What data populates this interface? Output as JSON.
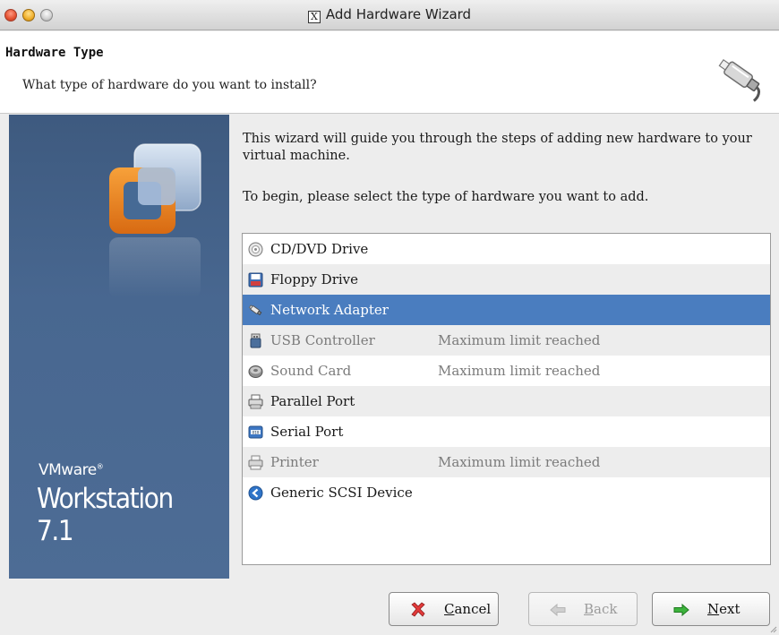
{
  "window": {
    "title": "Add Hardware Wizard"
  },
  "header": {
    "title": "Hardware Type",
    "subtitle": "What type of hardware do you want to install?"
  },
  "banner": {
    "brand_line1": "VMware",
    "brand_mark": "®",
    "brand_line2": "Workstation 7.1"
  },
  "intro": {
    "line1": "This wizard will guide you through the steps of adding new hardware to your virtual machine.",
    "line2": "To begin, please select the type of hardware you want to add."
  },
  "hardware_list": {
    "items": [
      {
        "label": "CD/DVD Drive",
        "note": "",
        "icon": "cd-icon",
        "state": "enabled"
      },
      {
        "label": "Floppy Drive",
        "note": "",
        "icon": "floppy-icon",
        "state": "enabled"
      },
      {
        "label": "Network Adapter",
        "note": "",
        "icon": "network-icon",
        "state": "selected"
      },
      {
        "label": "USB Controller",
        "note": "Maximum limit reached",
        "icon": "usb-icon",
        "state": "disabled"
      },
      {
        "label": "Sound Card",
        "note": "Maximum limit reached",
        "icon": "speaker-icon",
        "state": "disabled"
      },
      {
        "label": "Parallel Port",
        "note": "",
        "icon": "parallel-port-icon",
        "state": "enabled"
      },
      {
        "label": "Serial Port",
        "note": "",
        "icon": "serial-port-icon",
        "state": "enabled"
      },
      {
        "label": "Printer",
        "note": "Maximum limit reached",
        "icon": "printer-icon",
        "state": "disabled"
      },
      {
        "label": "Generic SCSI Device",
        "note": "",
        "icon": "scsi-icon",
        "state": "enabled"
      }
    ]
  },
  "buttons": {
    "cancel_label": "Cancel",
    "back_label": "Back",
    "next_label": "Next"
  },
  "colors": {
    "selection": "#4a7dbf",
    "banner": "#486790"
  }
}
